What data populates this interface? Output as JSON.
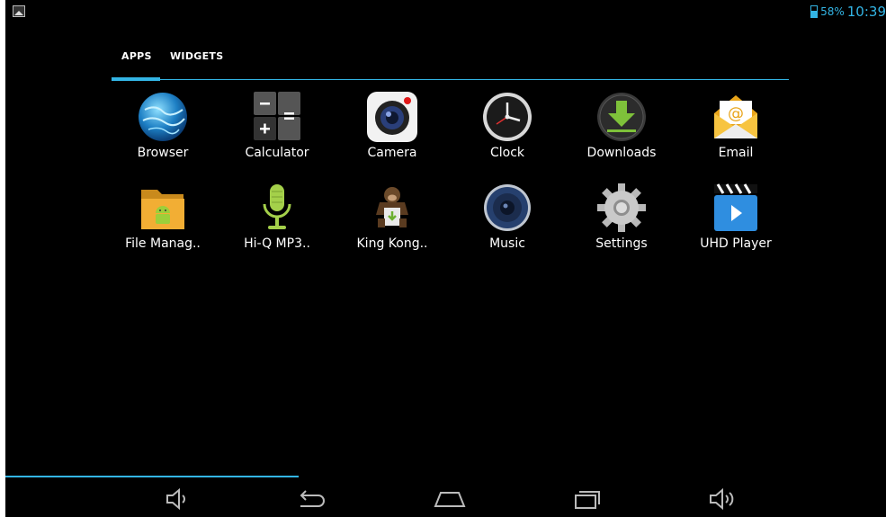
{
  "status": {
    "battery_pct": "58%",
    "battery_level": 0.58,
    "time": "10:39",
    "notification_icon": "image-icon",
    "accent": "#33b5e5"
  },
  "tabs": [
    {
      "label": "APPS",
      "active": true
    },
    {
      "label": "WIDGETS",
      "active": false
    }
  ],
  "apps": [
    {
      "label": "Browser",
      "icon": "globe-icon"
    },
    {
      "label": "Calculator",
      "icon": "calculator-icon"
    },
    {
      "label": "Camera",
      "icon": "camera-icon"
    },
    {
      "label": "Clock",
      "icon": "clock-icon"
    },
    {
      "label": "Downloads",
      "icon": "download-icon"
    },
    {
      "label": "Email",
      "icon": "email-icon"
    },
    {
      "label": "File Manag..",
      "icon": "folder-android-icon"
    },
    {
      "label": "Hi-Q MP3..",
      "icon": "microphone-icon"
    },
    {
      "label": "King Kong..",
      "icon": "gorilla-icon"
    },
    {
      "label": "Music",
      "icon": "speaker-icon"
    },
    {
      "label": "Settings",
      "icon": "gear-icon"
    },
    {
      "label": "UHD Player",
      "icon": "clapperboard-icon"
    }
  ],
  "navbar": {
    "items": [
      "volume-down-icon",
      "back-icon",
      "home-icon",
      "recent-apps-icon",
      "volume-up-icon"
    ]
  }
}
